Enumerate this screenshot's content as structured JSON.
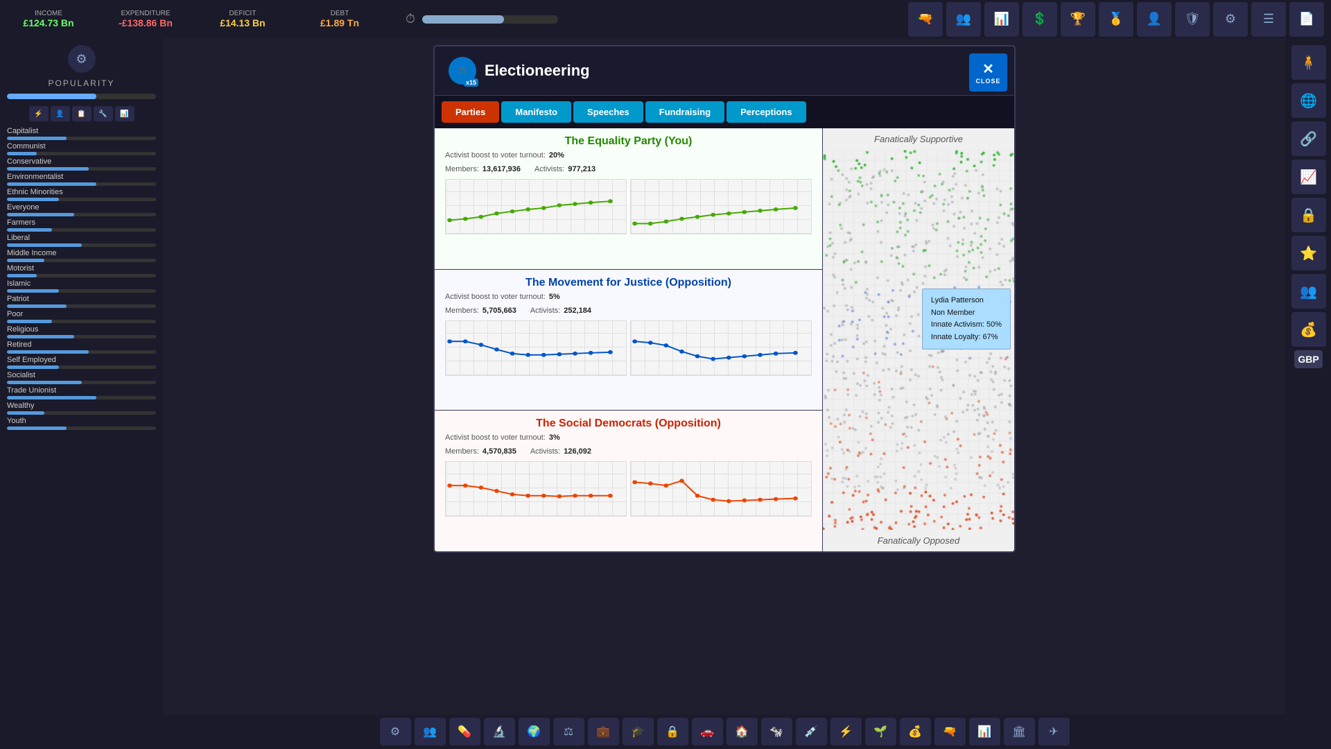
{
  "topbar": {
    "income_label": "INCOME",
    "income_value": "£124.73 Bn",
    "expenditure_label": "EXPENDITURE",
    "expenditure_value": "-£138.86 Bn",
    "deficit_label": "DEFICIT",
    "deficit_value": "£14.13 Bn",
    "debt_label": "DEBT",
    "debt_value": "£1.89 Tn"
  },
  "sidebar": {
    "popularity_label": "POPULARITY",
    "groups": [
      {
        "name": "Capitalist",
        "fill": 40
      },
      {
        "name": "Communist",
        "fill": 20
      },
      {
        "name": "Conservative",
        "fill": 55
      },
      {
        "name": "Environmentalist",
        "fill": 60
      },
      {
        "name": "Ethnic Minorities",
        "fill": 35
      },
      {
        "name": "Everyone",
        "fill": 45
      },
      {
        "name": "Farmers",
        "fill": 30
      },
      {
        "name": "Liberal",
        "fill": 50
      },
      {
        "name": "Middle Income",
        "fill": 25
      },
      {
        "name": "Motorist",
        "fill": 20
      },
      {
        "name": "Islamic",
        "fill": 35
      },
      {
        "name": "Patriot",
        "fill": 40
      },
      {
        "name": "Poor",
        "fill": 30
      },
      {
        "name": "Religious",
        "fill": 45
      },
      {
        "name": "Retired",
        "fill": 55
      },
      {
        "name": "Self Employed",
        "fill": 35
      },
      {
        "name": "Socialist",
        "fill": 50
      },
      {
        "name": "Trade Unionist",
        "fill": 60
      },
      {
        "name": "Wealthy",
        "fill": 25
      },
      {
        "name": "Youth",
        "fill": 40
      }
    ]
  },
  "modal": {
    "title": "Electioneering",
    "close_label": "CLOSE",
    "badge_multiplier": "x15",
    "tabs": [
      {
        "id": "parties",
        "label": "Parties",
        "active": true
      },
      {
        "id": "manifesto",
        "label": "Manifesto",
        "active": false
      },
      {
        "id": "speeches",
        "label": "Speeches",
        "active": false
      },
      {
        "id": "fundraising",
        "label": "Fundraising",
        "active": false
      },
      {
        "id": "perceptions",
        "label": "Perceptions",
        "active": false
      }
    ],
    "parties": [
      {
        "name": "The Equality Party (You)",
        "color": "green",
        "activist_boost": "20%",
        "members": "13,617,936",
        "activists": "977,213",
        "color_hex": "#44aa00"
      },
      {
        "name": "The Movement for Justice (Opposition)",
        "color": "blue",
        "activist_boost": "5%",
        "members": "5,705,663",
        "activists": "252,184",
        "color_hex": "#0055cc"
      },
      {
        "name": "The Social Democrats (Opposition)",
        "color": "red",
        "activist_boost": "3%",
        "members": "4,570,835",
        "activists": "126,092",
        "color_hex": "#ee4400"
      }
    ],
    "perceptions": {
      "top_label": "Fanatically Supportive",
      "bottom_label": "Fanatically Opposed"
    },
    "tooltip": {
      "name": "Lydia Patterson",
      "type": "Non Member",
      "innate_activism": "50%",
      "innate_loyalty": "67%"
    }
  }
}
